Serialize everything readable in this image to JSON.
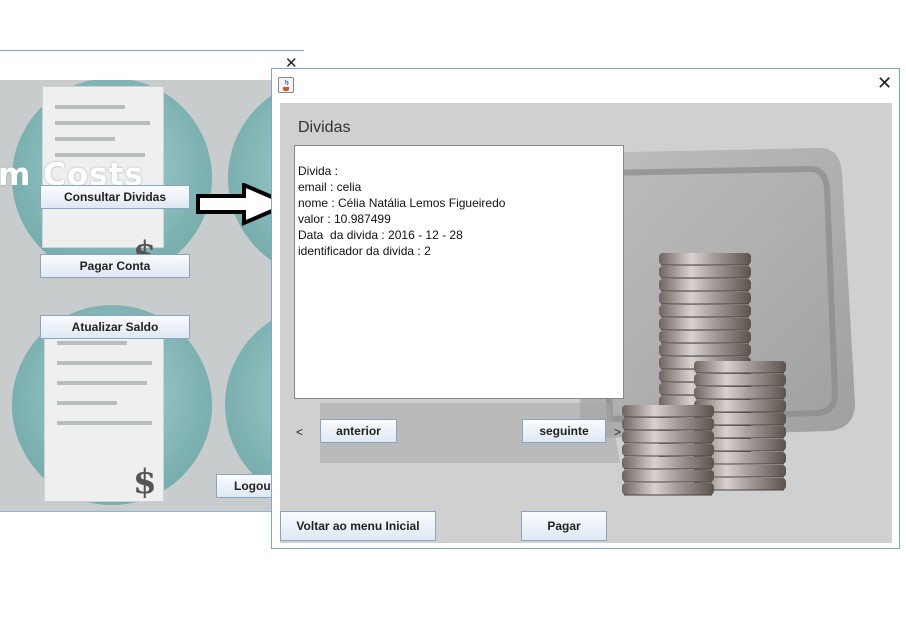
{
  "back_window": {
    "close_glyph": "✕",
    "app_title": "m Costs",
    "buttons": {
      "consultar": "Consultar Dividas",
      "pagar": "Pagar Conta",
      "atualizar": "Atualizar  Saldo",
      "logout": "Logout"
    }
  },
  "front_window": {
    "close_glyph": "✕",
    "section_title": "Dividas",
    "details": [
      "Divida :",
      "email : celia",
      "nome : Célia Natália Lemos Figueiredo",
      "valor : 10.987499",
      "Data  da divida : 2016 - 12 - 28",
      "identificador da divida : 2"
    ],
    "prev_glyph": "<",
    "next_glyph": ">",
    "buttons": {
      "anterior": "anterior",
      "seguinte": "seguinte",
      "voltar": "Voltar ao menu Inicial",
      "pagar": "Pagar"
    }
  },
  "icons": [
    "java-cup-icon",
    "close-icon",
    "arrow-right-icon",
    "dollar-icon",
    "receipt-icon",
    "coin-stack-icon"
  ]
}
